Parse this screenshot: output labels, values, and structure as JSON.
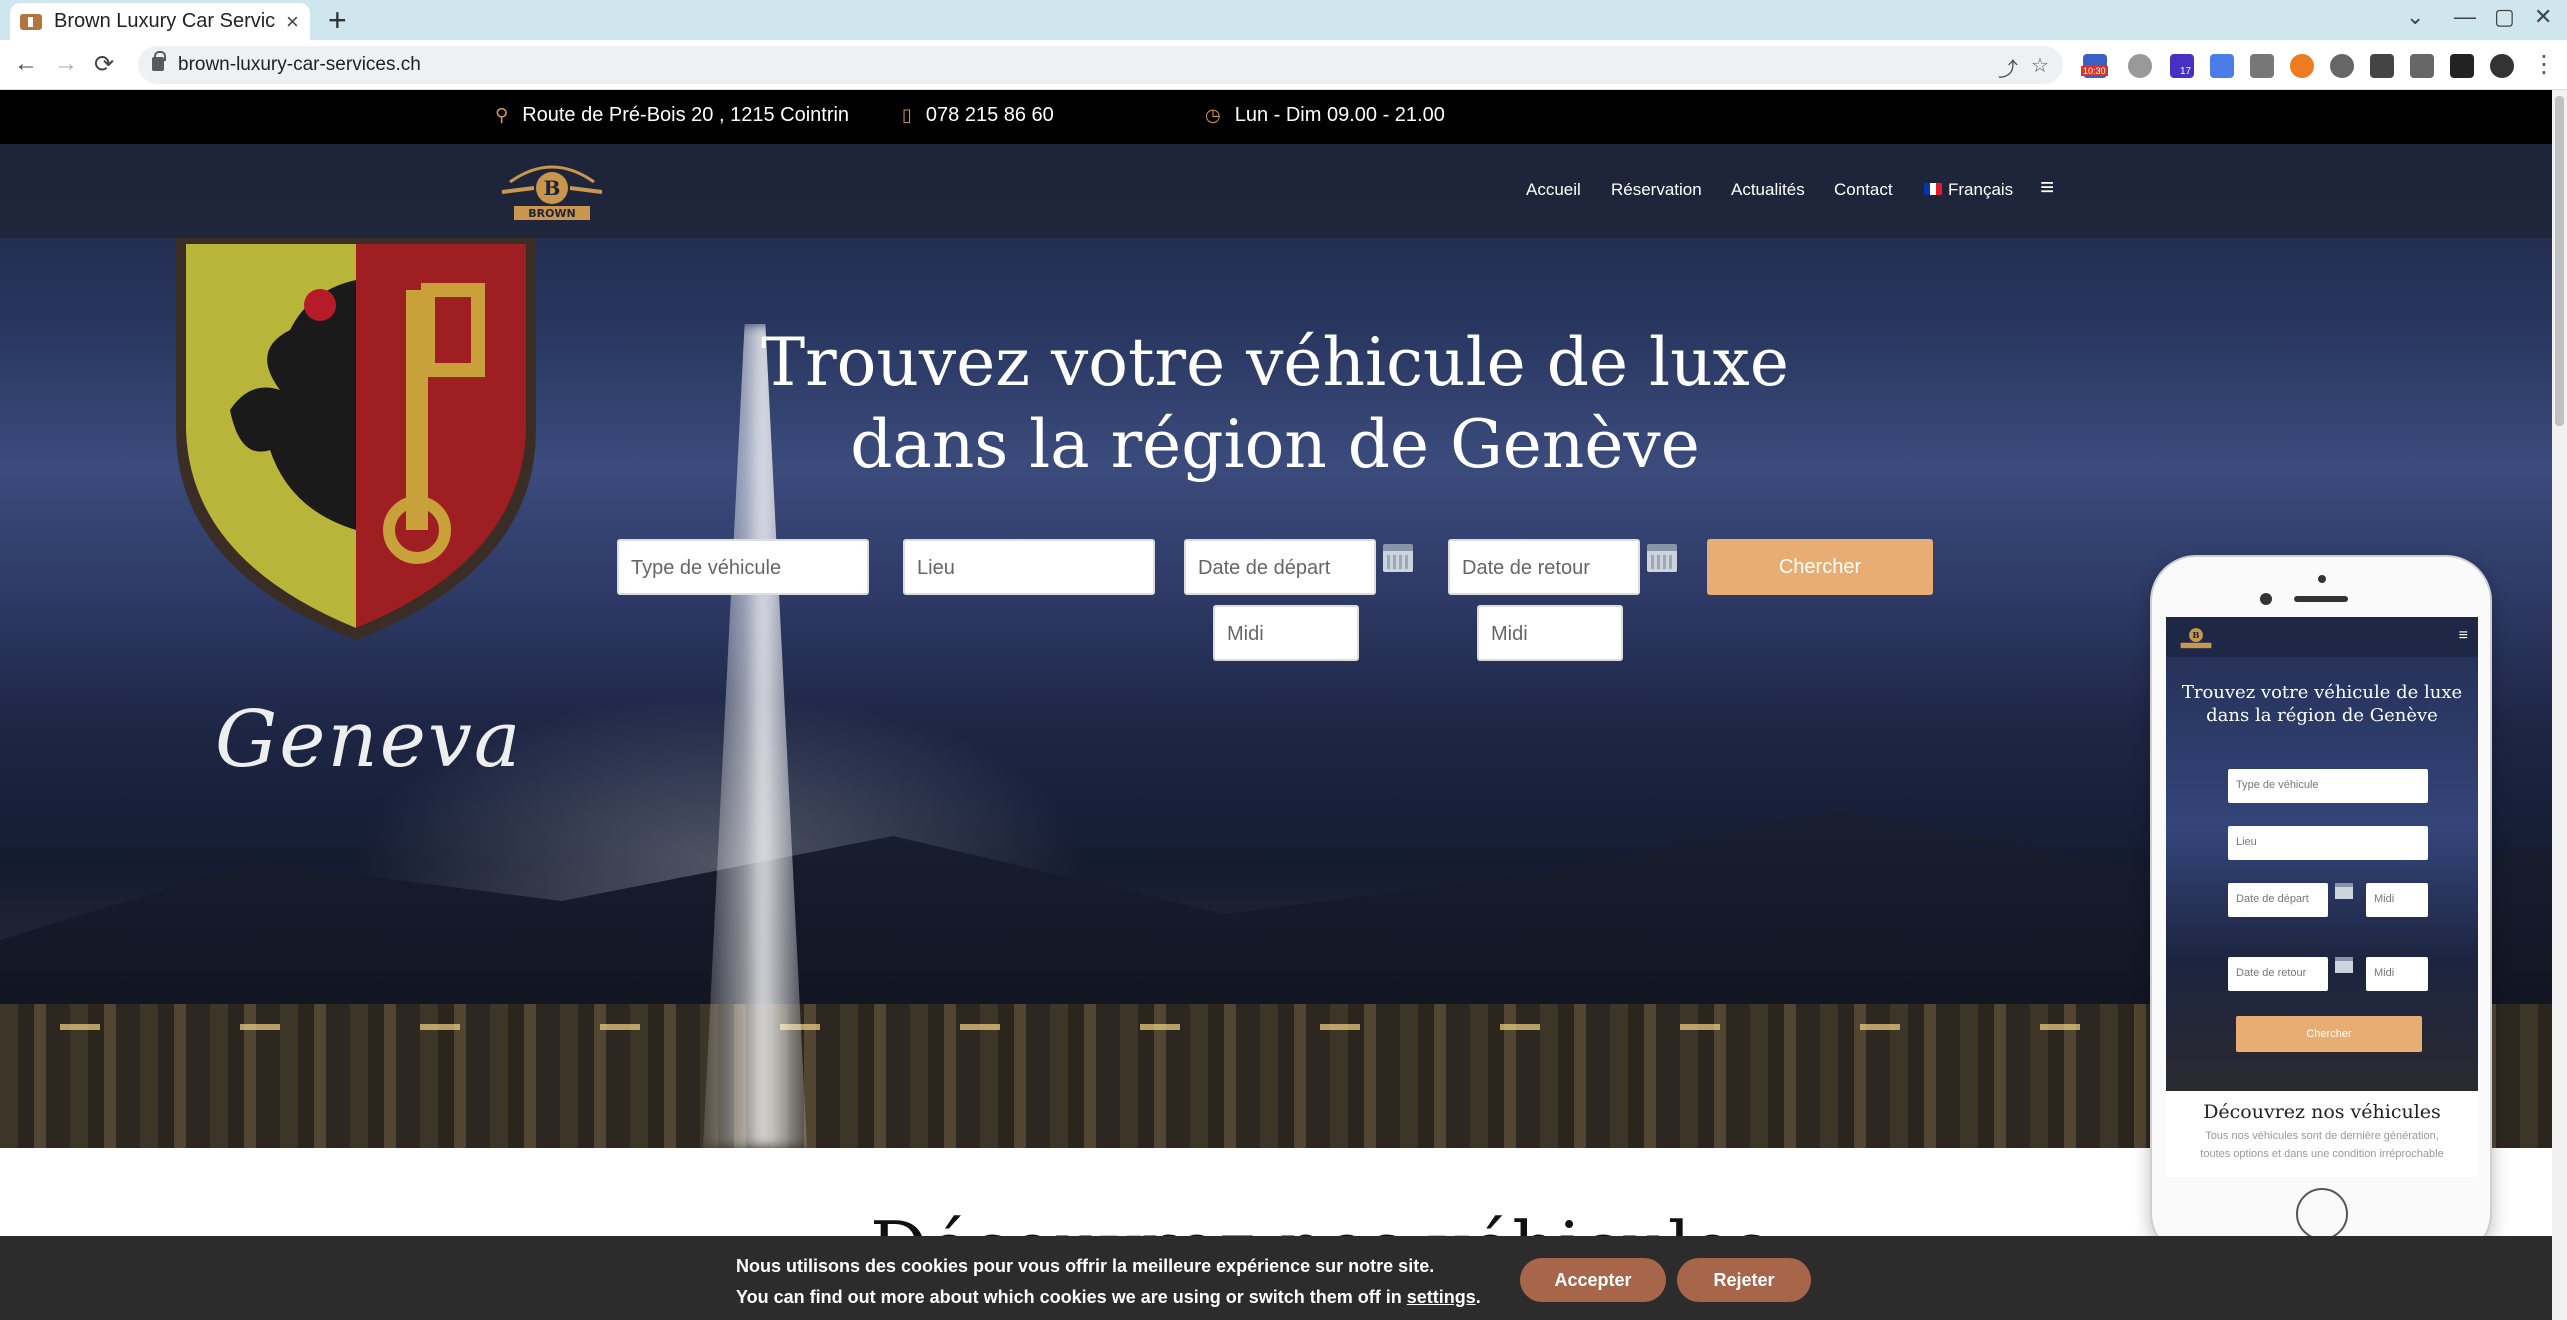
{
  "browser": {
    "tab_title": "Brown Luxury Car Service",
    "tab_close": "×",
    "new_tab": "+",
    "url": "brown-luxury-car-services.ch",
    "back": "←",
    "forward": "→",
    "reload": "⟳",
    "win_chevron": "⌄",
    "win_min": "—",
    "win_max": "▢",
    "win_close": "✕",
    "ext_badge_1": "10:30",
    "ext_badge_2": "17"
  },
  "topbar": {
    "address": "Route de Pré-Bois 20 , 1215 Cointrin",
    "phone": "078 215 86 60",
    "hours": "Lun - Dim 09.00 - 21.00"
  },
  "nav": {
    "items": [
      {
        "label": "Accueil"
      },
      {
        "label": "Réservation"
      },
      {
        "label": "Actualités"
      },
      {
        "label": "Contact"
      },
      {
        "label": "Français"
      }
    ],
    "hamburger": "≡"
  },
  "hero": {
    "title_line1": "Trouvez votre véhicule de luxe",
    "title_line2": "dans la région de Genève",
    "script_text": "Geneva"
  },
  "search": {
    "vehicle_type": "Type de véhicule",
    "location": "Lieu",
    "departure_date": "Date de départ",
    "return_date": "Date de retour",
    "departure_time": "Midi",
    "return_time": "Midi",
    "submit": "Chercher"
  },
  "mobile_preview": {
    "hamburger": "≡",
    "title_line1": "Trouvez votre véhicule de luxe",
    "title_line2": "dans la région de Genève",
    "vehicle_type": "Type de véhicule",
    "location": "Lieu",
    "departure_date": "Date de départ",
    "return_date": "Date de retour",
    "time": "Midi",
    "submit": "Chercher",
    "section_title": "Découvrez nos véhicules",
    "section_text_1": "Tous nos véhicules sont de dernière génération,",
    "section_text_2": "toutes options et dans une condition irréprochable"
  },
  "section": {
    "title_partial": "Découvrez nos véhicules"
  },
  "cookie": {
    "line1": "Nous utilisons des cookies pour vous offrir la meilleure expérience sur notre site.",
    "line2_prefix": "You can find out more about which cookies we are using or switch them off in ",
    "line2_link": "settings",
    "line2_suffix": ".",
    "accept": "Accepter",
    "reject": "Rejeter"
  },
  "colors": {
    "accent": "#e8ad73",
    "cookie_button": "#a7664a",
    "topbar_bg": "#000000",
    "tab_bar": "#cfe6ee"
  }
}
